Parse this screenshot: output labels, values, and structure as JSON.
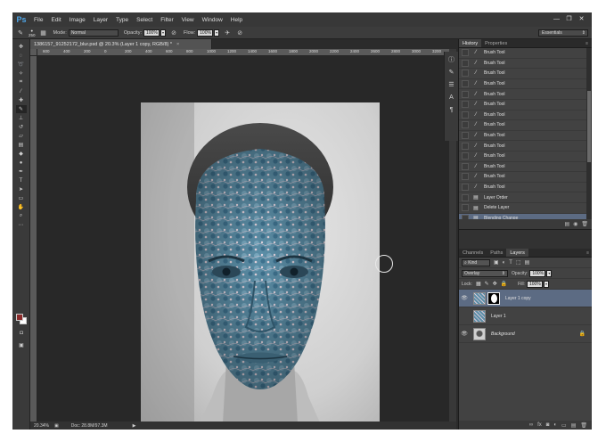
{
  "app": {
    "logo": "Ps",
    "menu": [
      "File",
      "Edit",
      "Image",
      "Layer",
      "Type",
      "Select",
      "Filter",
      "View",
      "Window",
      "Help"
    ],
    "window_controls": [
      "—",
      "❐",
      "✕"
    ]
  },
  "options": {
    "brush_size": "250",
    "mode_label": "Mode:",
    "mode_value": "Normal",
    "opacity_label": "Opacity:",
    "opacity_value": "100%",
    "flow_label": "Flow:",
    "flow_value": "100%",
    "workspace": "Essentials"
  },
  "document": {
    "tab_title": "1386157_91252172_blur.psd @ 20.3% (Layer 1 copy, RGB/8) *",
    "close": "×",
    "ruler_marks": [
      "600",
      "400",
      "200",
      "0",
      "200",
      "400",
      "600",
      "800",
      "1000",
      "1200",
      "1400",
      "1600",
      "1800",
      "2000",
      "2200",
      "2400",
      "2600",
      "2800",
      "3000",
      "3200"
    ],
    "zoom": "20.34%",
    "doc_size": "Doc: 28.8M/97.3M"
  },
  "history": {
    "tabs": [
      "History",
      "Properties"
    ],
    "items": [
      {
        "label": "Brush Tool",
        "icon": "brush-icon"
      },
      {
        "label": "Brush Tool",
        "icon": "brush-icon"
      },
      {
        "label": "Brush Tool",
        "icon": "brush-icon"
      },
      {
        "label": "Brush Tool",
        "icon": "brush-icon"
      },
      {
        "label": "Brush Tool",
        "icon": "brush-icon"
      },
      {
        "label": "Brush Tool",
        "icon": "brush-icon"
      },
      {
        "label": "Brush Tool",
        "icon": "brush-icon"
      },
      {
        "label": "Brush Tool",
        "icon": "brush-icon"
      },
      {
        "label": "Brush Tool",
        "icon": "brush-icon"
      },
      {
        "label": "Brush Tool",
        "icon": "brush-icon"
      },
      {
        "label": "Brush Tool",
        "icon": "brush-icon"
      },
      {
        "label": "Brush Tool",
        "icon": "brush-icon"
      },
      {
        "label": "Brush Tool",
        "icon": "brush-icon"
      },
      {
        "label": "Brush Tool",
        "icon": "brush-icon"
      },
      {
        "label": "Layer Order",
        "icon": "layer-order-icon"
      },
      {
        "label": "Delete Layer",
        "icon": "layer-icon"
      },
      {
        "label": "Blending Change",
        "icon": "layer-icon"
      }
    ]
  },
  "layers": {
    "tabs": [
      "Channels",
      "Paths",
      "Layers"
    ],
    "kind": "Kind",
    "blend_mode": "Overlay",
    "opacity_label": "Opacity:",
    "opacity_value": "100%",
    "lock_label": "Lock:",
    "fill_label": "Fill:",
    "fill_value": "100%",
    "items": [
      {
        "name": "Layer 1 copy",
        "visible": true,
        "selected": true,
        "has_mask": true
      },
      {
        "name": "Layer 1",
        "visible": false,
        "selected": false,
        "has_mask": false
      },
      {
        "name": "Background",
        "visible": true,
        "selected": false,
        "has_mask": false,
        "locked": true
      }
    ]
  },
  "colors": {
    "accent_selected": "#5c6b83",
    "foreground": "#8a2a2a",
    "background": "#ffffff"
  }
}
